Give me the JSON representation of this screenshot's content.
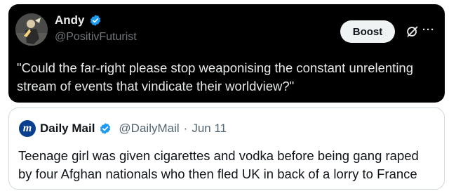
{
  "post": {
    "author_name": "Andy",
    "handle": "@PositivFuturist",
    "boost_label": "Boost",
    "more_label": "···",
    "text": "\"Could the far-right please stop weaponising the constant unrelenting stream of events that vindicate their worldview?\""
  },
  "quote": {
    "logo_text": "m",
    "author_name": "Daily Mail",
    "handle": "@DailyMail",
    "separator": "·",
    "date": "Jun 11",
    "text": "Teenage girl was given cigarettes and vodka before being gang raped by four Afghan nationals who then fled UK in back of a lorry to France"
  },
  "colors": {
    "dark_bg": "#000000",
    "verified_blue": "#1d9bf0",
    "daily_mail_blue": "#0a3f8f",
    "boost_bg": "#eff3f4"
  },
  "icons": [
    "verified-badge-icon",
    "grok-icon",
    "more-icon"
  ]
}
